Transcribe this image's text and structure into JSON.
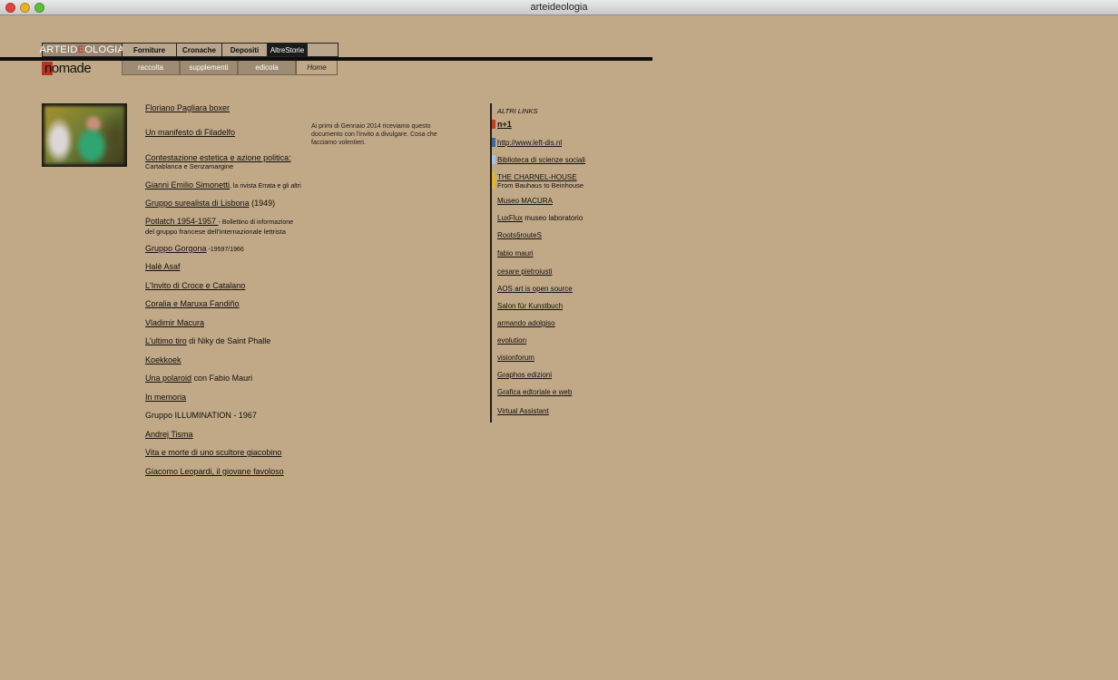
{
  "window": {
    "title": "arteideologia"
  },
  "nav_top": {
    "logo_prefix": "ARTEID",
    "logo_accent": "E",
    "logo_suffix": "OLOGIA",
    "items": [
      "Forniture",
      "Cronache",
      "Depositi",
      "AltreStorie"
    ]
  },
  "nav_bottom": {
    "logo_a": "no",
    "logo_b": "made",
    "items": [
      "raccolta",
      "supplementi",
      "edicola"
    ],
    "home": "Home"
  },
  "notice": "Ai primi di Gennaio 2014 riceviamo questo documento con l'invito a divulgare. Cosa che facciamo volentieri.",
  "links": [
    {
      "text": "Floriano Pagliara boxer"
    },
    {
      "text": "Un manifesto di Filadelfo"
    },
    {
      "text": "Contestazione estetica e azione politica:",
      "sub": "Cartablanca e Senzamargine"
    },
    {
      "text": "Gianni Emilio Simonetti",
      "extra_small": ", la rivista Errata e gli altri"
    },
    {
      "text": "Gruppo surealista di Lisbona",
      "extra": " (1949)"
    },
    {
      "text": "Potlatch 1954-1957 ",
      "extra_small": "- Bollettino di informazione",
      "sub": "del gruppo francese dell'Internazionale lettrista"
    },
    {
      "text": "Gruppo Gorgona",
      "extra_small": " -19597/1966"
    },
    {
      "text": "Halè Asaf"
    },
    {
      "text": "L'Invito di Croce e Catalano"
    },
    {
      "text": "Coralia e Maruxa Fandiño"
    },
    {
      "text": "Vladimir Macura"
    },
    {
      "text": "L'ultimo tiro",
      "extra": " di Niky de Saint Phalle"
    },
    {
      "text": "Koekkoek"
    },
    {
      "text": "Una polaroid",
      "extra": " con Fabio Mauri"
    },
    {
      "text": "In memoria"
    },
    {
      "plain": "Gruppo ILLUMINATION - 1967"
    },
    {
      "text": "Andrej Tisma"
    },
    {
      "text": "Vita e morte di uno scultore giacobino"
    },
    {
      "text": "Giacomo Leopardi, il giovane favoloso"
    }
  ],
  "altri_links": {
    "heading": "ALTRI LINKS",
    "items": [
      {
        "text": "n+1",
        "bold": true,
        "marker": "#cc3a1c"
      },
      {
        "text": "http://www.left-dis.nl",
        "marker": "#3c68a8"
      },
      {
        "text": "Biblioteca di scienze sociali",
        "marker": "#9fc4e6"
      },
      {
        "text": "THE CHARNEL-HOUSE",
        "sub": "From Bauhaus to Beinhouse",
        "marker": "#e2b52a"
      },
      {
        "text": "Museo MACURA"
      },
      {
        "text": "LuxFlux",
        "extra": " museo laboratorio"
      },
      {
        "text": "Roots§routeS"
      },
      {
        "text": "fabio mauri"
      },
      {
        "text": "cesare pietroiusti"
      },
      {
        "text": "AOS art is open source"
      },
      {
        "text": "Salon für Kunstbuch"
      },
      {
        "text": "armando adolgiso"
      },
      {
        "text": "evolution"
      },
      {
        "text": "visionforum"
      },
      {
        "text": "Graphos edizioni"
      },
      {
        "text": "Grafica edtoriale e web"
      },
      {
        "text": "Virtual Assistant"
      }
    ]
  }
}
